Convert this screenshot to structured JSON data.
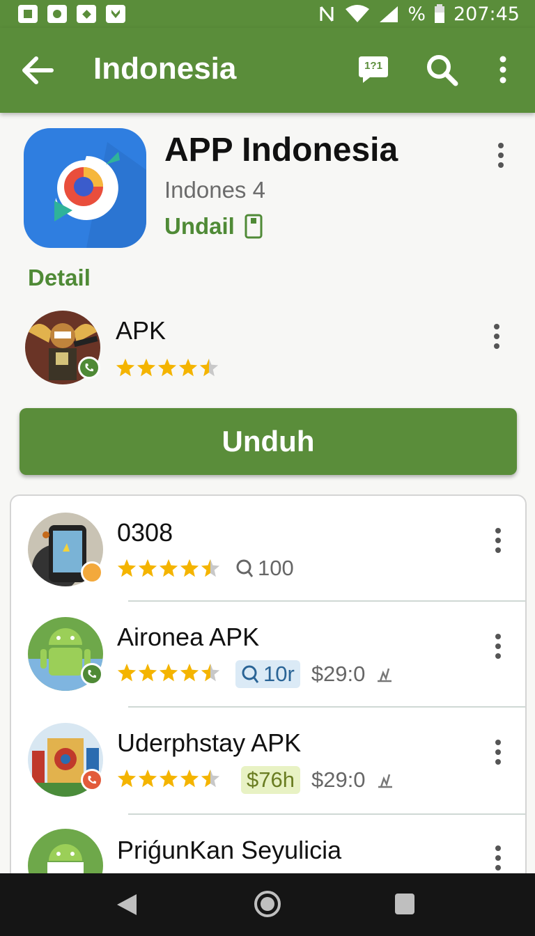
{
  "status_bar": {
    "time": "207:45",
    "battery_label": "%",
    "icons": [
      "screenshot-icon",
      "upload-icon",
      "mail-icon",
      "download-icon",
      "nfc-icon",
      "wifi-icon",
      "signal-icon",
      "battery-icon"
    ]
  },
  "app_bar": {
    "title": "Indonesia",
    "actions": [
      "back-arrow-icon",
      "chat-icon",
      "search-icon",
      "more-vert-icon"
    ],
    "chat_badge": "1?1"
  },
  "hero": {
    "title": "APP Indonesia",
    "subtitle": "Indones 4",
    "install_status": "Undail"
  },
  "section_label": "Detail",
  "featured": {
    "title": "APK",
    "rating": 4.5
  },
  "install_button": "Unduh",
  "colors": {
    "primary": "#5a8d3a",
    "accent_text": "#4f8a36",
    "star": "#f4b400"
  },
  "list": [
    {
      "title": "0308",
      "rating": 4.5,
      "meta1": "100",
      "meta1_style": "plain"
    },
    {
      "title": "Aironea APK",
      "rating": 4.5,
      "meta1": "10r",
      "meta1_style": "blue",
      "price": "$29:0"
    },
    {
      "title": "Uderphstay APK",
      "rating": 4.5,
      "meta1": "$76h",
      "meta1_style": "green",
      "price": "$29:0"
    },
    {
      "title": "PriǵunKan Seyulicia"
    }
  ]
}
